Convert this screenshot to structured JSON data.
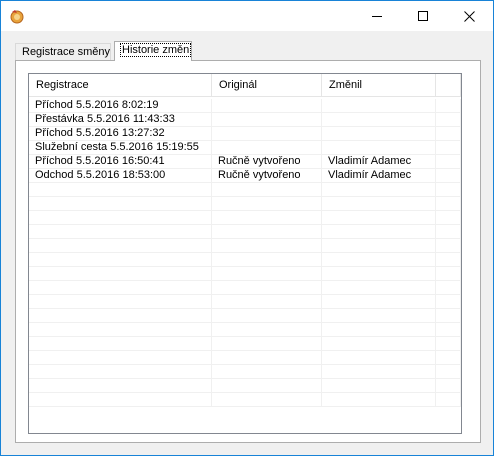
{
  "tabs": [
    {
      "label": "Registrace směny"
    },
    {
      "label": "Historie změn"
    }
  ],
  "table": {
    "columns": [
      "Registrace",
      "Originál",
      "Změnil"
    ],
    "rows": [
      {
        "registrace": "Příchod 5.5.2016 8:02:19",
        "original": "",
        "zmenil": ""
      },
      {
        "registrace": "Přestávka 5.5.2016 11:43:33",
        "original": "",
        "zmenil": ""
      },
      {
        "registrace": "Příchod 5.5.2016 13:27:32",
        "original": "",
        "zmenil": ""
      },
      {
        "registrace": "Služební cesta 5.5.2016 15:19:55",
        "original": "",
        "zmenil": ""
      },
      {
        "registrace": "Příchod 5.5.2016 16:50:41",
        "original": "Ručně vytvořeno",
        "zmenil": "Vladimír Adamec"
      },
      {
        "registrace": "Odchod 5.5.2016 18:53:00",
        "original": "Ručně vytvořeno",
        "zmenil": "Vladimír Adamec"
      }
    ]
  },
  "icons": {
    "app": "app-icon",
    "minimize": "minimize-icon",
    "maximize": "maximize-icon",
    "close": "close-icon"
  },
  "colors": {
    "title_bar": "#ffffff",
    "window_border": "#1883d7",
    "desktop": "#2b5c96"
  }
}
